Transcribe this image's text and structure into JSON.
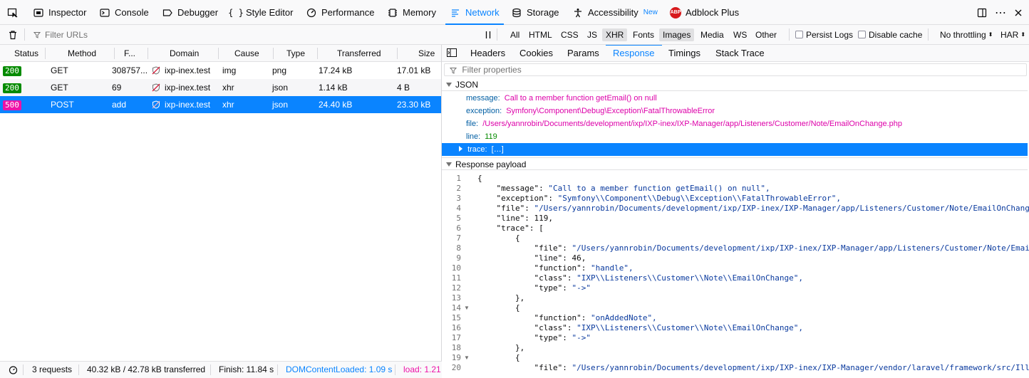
{
  "toolbox": {
    "tools": [
      {
        "label": "Inspector",
        "icon": "inspector-icon"
      },
      {
        "label": "Console",
        "icon": "console-icon"
      },
      {
        "label": "Debugger",
        "icon": "debugger-icon"
      },
      {
        "label": "Style Editor",
        "icon": "style-editor-icon"
      },
      {
        "label": "Performance",
        "icon": "performance-icon"
      },
      {
        "label": "Memory",
        "icon": "memory-icon"
      },
      {
        "label": "Network",
        "icon": "network-icon",
        "selected": true
      },
      {
        "label": "Storage",
        "icon": "storage-icon"
      },
      {
        "label": "Accessibility",
        "icon": "accessibility-icon",
        "badge": "New"
      },
      {
        "label": "Adblock Plus",
        "icon": "adblock-icon",
        "icon_text": "ABP"
      }
    ]
  },
  "filterbar": {
    "filter_placeholder": "Filter URLs",
    "types": [
      "All",
      "HTML",
      "CSS",
      "JS",
      "XHR",
      "Fonts",
      "Images",
      "Media",
      "WS",
      "Other"
    ],
    "active_types": [
      "XHR",
      "Images"
    ],
    "persist_logs": "Persist Logs",
    "disable_cache": "Disable cache",
    "throttling": "No throttling",
    "har": "HAR"
  },
  "requests": {
    "columns": {
      "status": "Status",
      "method": "Method",
      "file": "F...",
      "domain": "Domain",
      "cause": "Cause",
      "type": "Type",
      "transferred": "Transferred",
      "size": "Size"
    },
    "rows": [
      {
        "status": "200",
        "method": "GET",
        "file": "308757...",
        "domain": "ixp-inex.test",
        "cause": "img",
        "type": "png",
        "transferred": "17.24 kB",
        "size": "17.01 kB"
      },
      {
        "status": "200",
        "method": "GET",
        "file": "69",
        "domain": "ixp-inex.test",
        "cause": "xhr",
        "type": "json",
        "transferred": "1.14 kB",
        "size": "4 B"
      },
      {
        "status": "500",
        "method": "POST",
        "file": "add",
        "domain": "ixp-inex.test",
        "cause": "xhr",
        "type": "json",
        "transferred": "24.40 kB",
        "size": "23.30 kB",
        "selected": true
      }
    ]
  },
  "statusbar": {
    "requests": "3 requests",
    "transferred": "40.32 kB / 42.78 kB transferred",
    "finish": "Finish: 11.84 s",
    "domcontentloaded": "DOMContentLoaded: 1.09 s",
    "load": "load: 1.21 s"
  },
  "details": {
    "tabs": [
      "Headers",
      "Cookies",
      "Params",
      "Response",
      "Timings",
      "Stack Trace"
    ],
    "selected_tab": "Response",
    "filter_placeholder": "Filter properties",
    "json_section": "JSON",
    "props": [
      {
        "key": "message:",
        "value": "Call to a member function getEmail() on null"
      },
      {
        "key": "exception:",
        "value": "Symfony\\Component\\Debug\\Exception\\FatalThrowableError"
      },
      {
        "key": "file:",
        "value": "/Users/yannrobin/Documents/development/ixp/IXP-inex/IXP-Manager/app/Listeners/Customer/Note/EmailOnChange.php"
      },
      {
        "key": "line:",
        "value": "119"
      },
      {
        "key": "trace:",
        "value": "[…]",
        "selected": true
      }
    ],
    "payload_section": "Response payload",
    "code_lines": [
      "{",
      "    \"message\": \"Call to a member function getEmail() on null\",",
      "    \"exception\": \"Symfony\\\\Component\\\\Debug\\\\Exception\\\\FatalThrowableError\",",
      "    \"file\": \"/Users/yannrobin/Documents/development/ixp/IXP-inex/IXP-Manager/app/Listeners/Customer/Note/EmailOnChange.php\",",
      "    \"line\": 119,",
      "    \"trace\": [",
      "        {",
      "            \"file\": \"/Users/yannrobin/Documents/development/ixp/IXP-inex/IXP-Manager/app/Listeners/Customer/Note/EmailOnChange.php\",",
      "            \"line\": 46,",
      "            \"function\": \"handle\",",
      "            \"class\": \"IXP\\\\Listeners\\\\Customer\\\\Note\\\\EmailOnChange\",",
      "            \"type\": \"->\"",
      "        },",
      "        {",
      "            \"function\": \"onAddedNote\",",
      "            \"class\": \"IXP\\\\Listeners\\\\Customer\\\\Note\\\\EmailOnChange\",",
      "            \"type\": \"->\"",
      "        },",
      "        {",
      "            \"file\": \"/Users/yannrobin/Documents/development/ixp/IXP-inex/IXP-Manager/vendor/laravel/framework/src/Illuminate/Events/Dispatcher.php\","
    ],
    "folded_lines": [
      14,
      19
    ]
  },
  "colors": {
    "accent": "#0a84ff",
    "ok": "#058b00",
    "error": "#ed12a8"
  }
}
